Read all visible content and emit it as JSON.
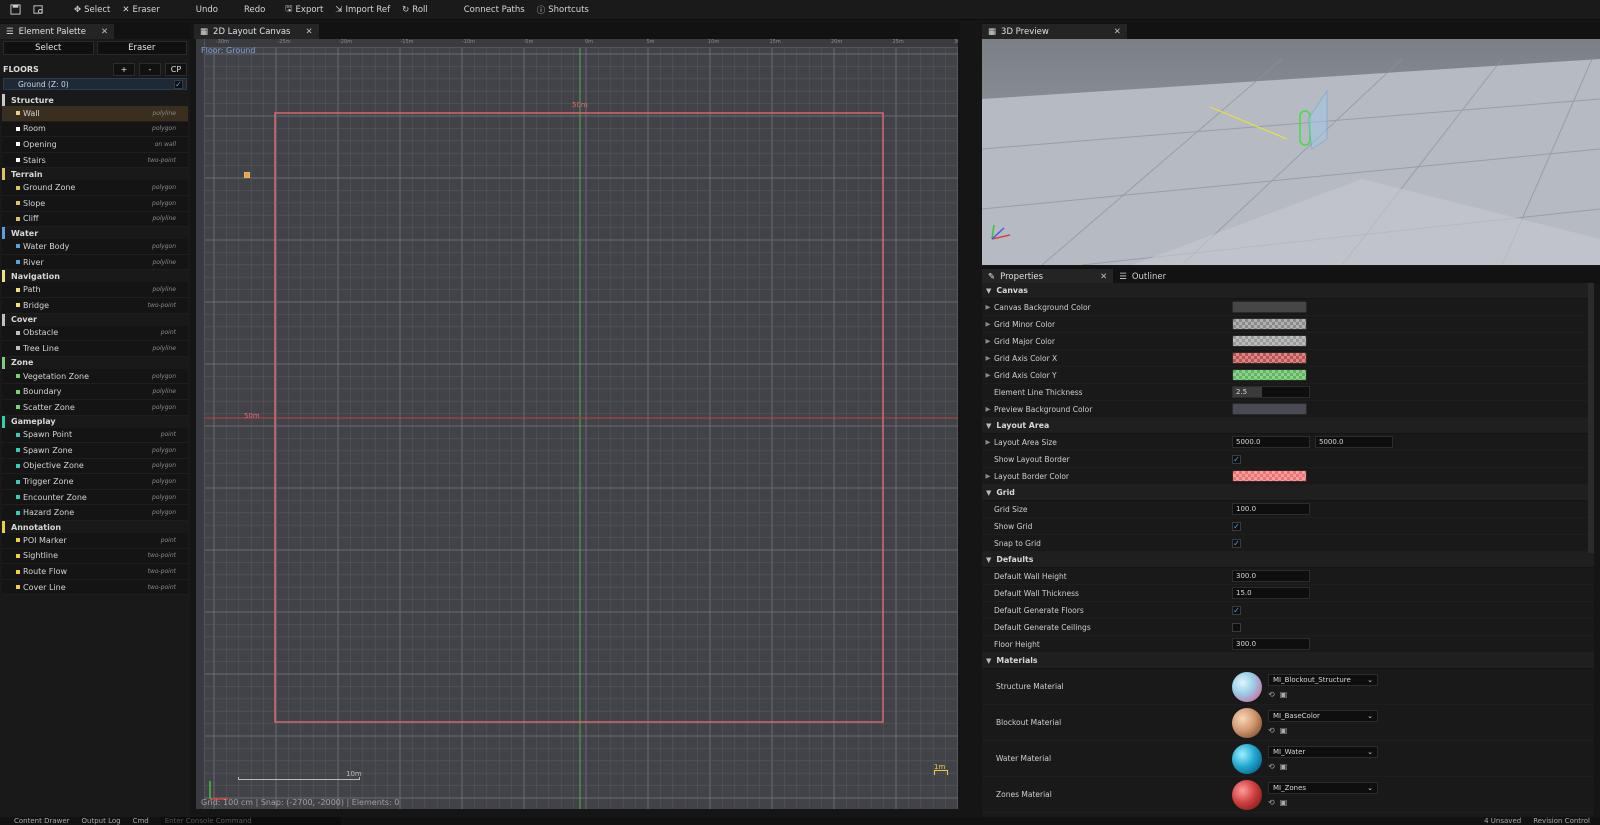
{
  "toolbar": {
    "items": [
      "Select",
      "Eraser",
      "Undo",
      "Redo",
      "Export",
      "Import Ref",
      "Roll",
      "Connect Paths",
      "Shortcuts"
    ]
  },
  "tabs": {
    "palette": "Element Palette",
    "canvas": "2D Layout Canvas",
    "preview": "3D Preview",
    "properties": "Properties",
    "outliner": "Outliner"
  },
  "palette": {
    "select": "Select",
    "eraser": "Eraser",
    "floors_title": "FLOORS",
    "floor_add": "+",
    "floor_remove": "-",
    "floor_cp": "CP",
    "floor_row": "Ground  (Z: 0)",
    "categories": [
      {
        "name": "Structure",
        "color": "#c9c9c9",
        "items": [
          {
            "label": "Wall",
            "kind": "polyline",
            "color": "#e8d08a",
            "selected": true
          },
          {
            "label": "Room",
            "kind": "polygon",
            "color": "#ffffff"
          },
          {
            "label": "Opening",
            "kind": "on wall",
            "color": "#ffffff"
          },
          {
            "label": "Stairs",
            "kind": "two-point",
            "color": "#ffffff"
          }
        ]
      },
      {
        "name": "Terrain",
        "color": "#e0c060",
        "items": [
          {
            "label": "Ground Zone",
            "kind": "polygon",
            "color": "#e0c060"
          },
          {
            "label": "Slope",
            "kind": "polygon",
            "color": "#e0c060"
          },
          {
            "label": "Cliff",
            "kind": "polyline",
            "color": "#e0c060"
          }
        ]
      },
      {
        "name": "Water",
        "color": "#5aa0e0",
        "items": [
          {
            "label": "Water Body",
            "kind": "polygon",
            "color": "#5aa0e0"
          },
          {
            "label": "River",
            "kind": "polyline",
            "color": "#5aa0e0"
          }
        ]
      },
      {
        "name": "Navigation",
        "color": "#f0e080",
        "items": [
          {
            "label": "Path",
            "kind": "polyline",
            "color": "#f0e080"
          },
          {
            "label": "Bridge",
            "kind": "two-point",
            "color": "#f0e080"
          }
        ]
      },
      {
        "name": "Cover",
        "color": "#c0c0c0",
        "items": [
          {
            "label": "Obstacle",
            "kind": "point",
            "color": "#c0c0c0"
          },
          {
            "label": "Tree Line",
            "kind": "polyline",
            "color": "#c0c0c0"
          }
        ]
      },
      {
        "name": "Zone",
        "color": "#7ad07a",
        "items": [
          {
            "label": "Vegetation Zone",
            "kind": "polygon",
            "color": "#7ad07a"
          },
          {
            "label": "Boundary",
            "kind": "polyline",
            "color": "#7ad07a"
          },
          {
            "label": "Scatter Zone",
            "kind": "polygon",
            "color": "#7ad07a"
          }
        ]
      },
      {
        "name": "Gameplay",
        "color": "#30d0b0",
        "items": [
          {
            "label": "Spawn Point",
            "kind": "point",
            "color": "#30d0b0"
          },
          {
            "label": "Spawn Zone",
            "kind": "polygon",
            "color": "#30d0b0"
          },
          {
            "label": "Objective Zone",
            "kind": "polygon",
            "color": "#30d0b0"
          },
          {
            "label": "Trigger Zone",
            "kind": "polygon",
            "color": "#30d0b0"
          },
          {
            "label": "Encounter Zone",
            "kind": "polygon",
            "color": "#30d0b0"
          },
          {
            "label": "Hazard Zone",
            "kind": "polygon",
            "color": "#30d0b0"
          }
        ]
      },
      {
        "name": "Annotation",
        "color": "#f0d040",
        "items": [
          {
            "label": "POI Marker",
            "kind": "point",
            "color": "#f0d040"
          },
          {
            "label": "Sightline",
            "kind": "two-point",
            "color": "#f0d040"
          },
          {
            "label": "Route Flow",
            "kind": "two-point",
            "color": "#f0d040"
          },
          {
            "label": "Cover Line",
            "kind": "two-point",
            "color": "#f0d040"
          }
        ]
      }
    ]
  },
  "canvas": {
    "floor_label": "Floor: Ground",
    "status": "Grid: 100 cm  |  Snap: (-2700, -2000)  |  Elements: 0",
    "top_ticks": [
      "-30m",
      "-25m",
      "-20m",
      "-15m",
      "-10m",
      "-5m",
      "0m",
      "5m",
      "10m",
      "15m",
      "20m",
      "25m",
      "30m"
    ],
    "dim_label_top": "50m",
    "dim_label_left": "50m",
    "scale_label": "10m",
    "scale_right": "1m",
    "border_color": "#e06a6a",
    "axis_y_color": "#4caf50",
    "axis_x_color": "#c04040"
  },
  "properties": {
    "sections": [
      {
        "title": "Canvas",
        "rows": [
          {
            "name": "Canvas Background Color",
            "type": "color",
            "color": "#464646",
            "expand": true
          },
          {
            "name": "Grid Minor Color",
            "type": "color",
            "color": "#8a8a8a",
            "expand": true,
            "checker": true
          },
          {
            "name": "Grid Major Color",
            "type": "color",
            "color": "#9a9a9a",
            "expand": true,
            "checker": true
          },
          {
            "name": "Grid Axis Color X",
            "type": "color",
            "color": "#c0504d",
            "expand": true,
            "checker": true
          },
          {
            "name": "Grid Axis Color Y",
            "type": "color",
            "color": "#5cb85c",
            "expand": true,
            "checker": true
          },
          {
            "name": "Element Line Thickness",
            "type": "short",
            "value": "2.5"
          },
          {
            "name": "Preview Background Color",
            "type": "color",
            "color": "#4a4a55",
            "expand": true
          }
        ]
      },
      {
        "title": "Layout Area",
        "rows": [
          {
            "name": "Layout Area Size",
            "type": "pair",
            "value": "5000.0",
            "value2": "5000.0",
            "expand": true
          },
          {
            "name": "Show Layout Border",
            "type": "check",
            "checked": true
          },
          {
            "name": "Layout Border Color",
            "type": "color",
            "color": "#f07070",
            "expand": true,
            "checker": true
          }
        ]
      },
      {
        "title": "Grid",
        "rows": [
          {
            "name": "Grid Size",
            "type": "num",
            "value": "100.0"
          },
          {
            "name": "Show Grid",
            "type": "check",
            "checked": true
          },
          {
            "name": "Snap to Grid",
            "type": "check",
            "checked": true
          }
        ]
      },
      {
        "title": "Defaults",
        "rows": [
          {
            "name": "Default Wall Height",
            "type": "num",
            "value": "300.0"
          },
          {
            "name": "Default Wall Thickness",
            "type": "num",
            "value": "15.0"
          },
          {
            "name": "Default Generate Floors",
            "type": "check",
            "checked": true
          },
          {
            "name": "Default Generate Ceilings",
            "type": "check",
            "checked": false
          },
          {
            "name": "Floor Height",
            "type": "num",
            "value": "300.0"
          }
        ]
      },
      {
        "title": "Materials",
        "rows": [
          {
            "name": "Structure Material",
            "type": "mat",
            "value": "MI_Blockout_Structure",
            "ball": "radial-gradient(circle at 35% 35%,#e0f4ff,#9ad0e8 40%,#c080b0 75%,#603050)"
          },
          {
            "name": "Blockout Material",
            "type": "mat",
            "value": "MI_BaseColor",
            "ball": "radial-gradient(circle at 35% 35%,#f8d8b8,#d09870 45%,#8a5a38 80%,#4a2a18)"
          },
          {
            "name": "Water Material",
            "type": "mat",
            "value": "MI_Water",
            "ball": "radial-gradient(circle at 35% 35%,#9ff0ff,#20a8d0 45%,#0a6a90 80%,#053048)"
          },
          {
            "name": "Zones Material",
            "type": "mat",
            "value": "MI_Zones",
            "ball": "radial-gradient(circle at 35% 35%,#ff9a9a,#d04040 45%,#902020 80%)"
          }
        ]
      }
    ]
  },
  "bottom": {
    "items": [
      "Content Drawer",
      "Output Log",
      "Cmd",
      "Enter Console Command"
    ],
    "right": [
      "4 Unsaved",
      "Revision Control"
    ]
  }
}
